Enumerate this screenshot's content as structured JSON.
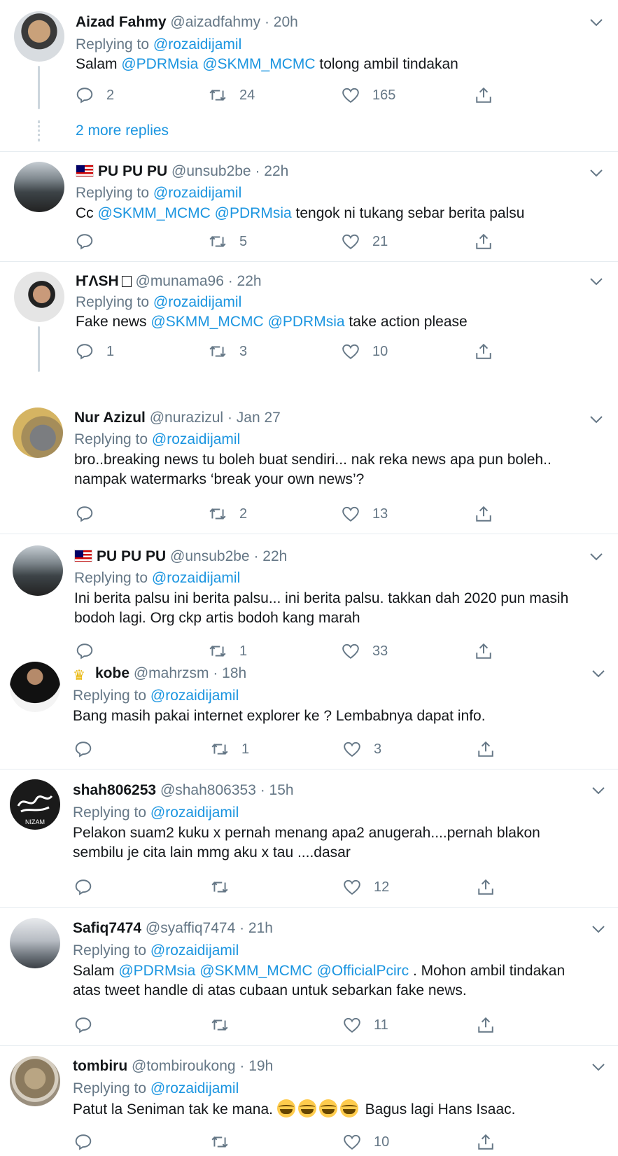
{
  "replying_label": "Replying to",
  "more_replies": "2 more replies",
  "tweets": [
    {
      "name": "Aizad Fahmy",
      "handle": "@aizadfahmy",
      "time": "· 20h",
      "reply_to": "@rozaidijamil",
      "text_parts": [
        "Salam ",
        "@PDRMsia",
        " ",
        "@SKMM_MCMC",
        " tolong ambil tindakan"
      ],
      "replies": "2",
      "retweets": "24",
      "likes": "165"
    },
    {
      "name": "PU PU PU",
      "handle": "@unsub2be",
      "time": "· 22h",
      "reply_to": "@rozaidijamil",
      "text_parts": [
        "Cc ",
        "@SKMM_MCMC",
        " ",
        "@PDRMsia",
        " tengok ni tukang sebar berita palsu"
      ],
      "replies": "",
      "retweets": "5",
      "likes": "21"
    },
    {
      "name": "ҤΛSH",
      "handle": "@munama96",
      "time": "· 22h",
      "reply_to": "@rozaidijamil",
      "text_parts": [
        "Fake news ",
        "@SKMM_MCMC",
        " ",
        "@PDRMsia",
        " take action please"
      ],
      "replies": "1",
      "retweets": "3",
      "likes": "10"
    },
    {
      "name": "Nur Azizul",
      "handle": "@nurazizul",
      "time": "· Jan 27",
      "reply_to": "@rozaidijamil",
      "text": "bro..breaking news tu boleh buat sendiri... nak reka news apa pun boleh.. nampak watermarks ‘break your own news’?",
      "replies": "",
      "retweets": "2",
      "likes": "13"
    },
    {
      "name": "PU PU PU",
      "handle": "@unsub2be",
      "time": "· 22h",
      "reply_to": "@rozaidijamil",
      "text": "Ini berita palsu ini berita palsu... ini berita palsu. takkan dah 2020 pun masih bodoh lagi. Org ckp artis bodoh kang marah",
      "replies": "",
      "retweets": "1",
      "likes": "33"
    },
    {
      "name": "kobe",
      "handle": "@mahrzsm",
      "time": "· 18h",
      "reply_to": "@rozaidijamil",
      "text": "Bang masih pakai internet explorer ke ? Lembabnya dapat info.",
      "replies": "",
      "retweets": "1",
      "likes": "3"
    },
    {
      "name": "shah806253",
      "handle": "@shah806353",
      "time": "· 15h",
      "reply_to": "@rozaidijamil",
      "text": "Pelakon suam2 kuku x pernah menang apa2 anugerah....pernah blakon sembilu je cita lain mmg aku x tau ....dasar",
      "avatar_text": "NIZAM",
      "replies": "",
      "retweets": "",
      "likes": "12"
    },
    {
      "name": "Safiq7474",
      "handle": "@syaffiq7474",
      "time": "· 21h",
      "reply_to": "@rozaidijamil",
      "text_parts": [
        "Salam ",
        "@PDRMsia",
        " ",
        "@SKMM_MCMC",
        " ",
        "@OfficialPcirc",
        " . Mohon ambil tindakan atas tweet handle di atas cubaan untuk sebarkan fake news."
      ],
      "replies": "",
      "retweets": "",
      "likes": "11"
    },
    {
      "name": "tombiru",
      "handle": "@tombiroukong",
      "time": "· 19h",
      "reply_to": "@rozaidijamil",
      "text_before": "Patut la Seniman tak ke mana. ",
      "text_after": " Bagus lagi Hans Isaac.",
      "replies": "",
      "retweets": "",
      "likes": "10"
    }
  ],
  "colors": {
    "link": "#1b95e0",
    "muted": "#657786",
    "divider": "#e6ecf0"
  }
}
